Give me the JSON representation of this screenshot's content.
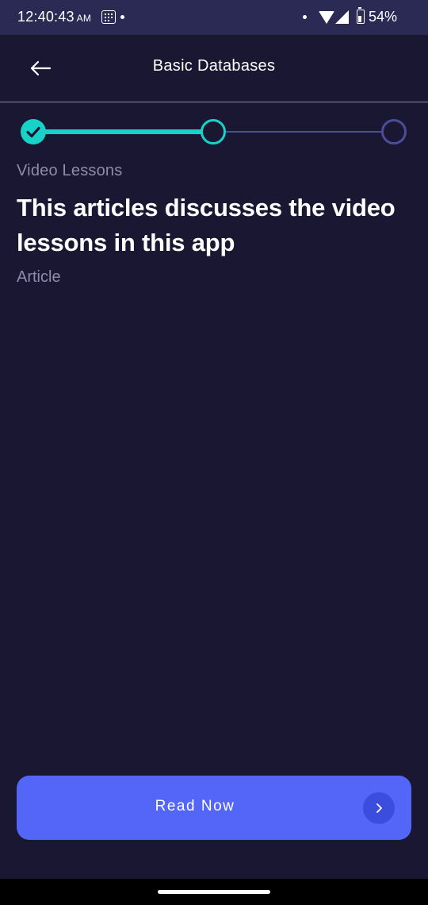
{
  "status_bar": {
    "time": "12:40:43",
    "ampm": "AM",
    "battery_percent": "54%",
    "icons": [
      "calendar-grid-icon",
      "notification-dot-icon",
      "wifi-icon",
      "signal-icon",
      "battery-charging-icon"
    ]
  },
  "header": {
    "title": "Basic Databases",
    "back_icon": "arrow-left-icon"
  },
  "stepper": {
    "steps": [
      {
        "state": "completed",
        "icon": "check-icon"
      },
      {
        "state": "current"
      },
      {
        "state": "upcoming"
      }
    ],
    "colors": {
      "active": "#18d2c7",
      "inactive": "#4c4c9a"
    }
  },
  "content": {
    "category": "Video Lessons",
    "title": "This articles discusses the video lessons in this app",
    "type": "Article"
  },
  "action": {
    "label": "Read Now",
    "icon": "chevron-right-icon",
    "color": "#5366f7"
  },
  "colors": {
    "background": "#1a1733",
    "status_bar": "#2b2a54"
  }
}
